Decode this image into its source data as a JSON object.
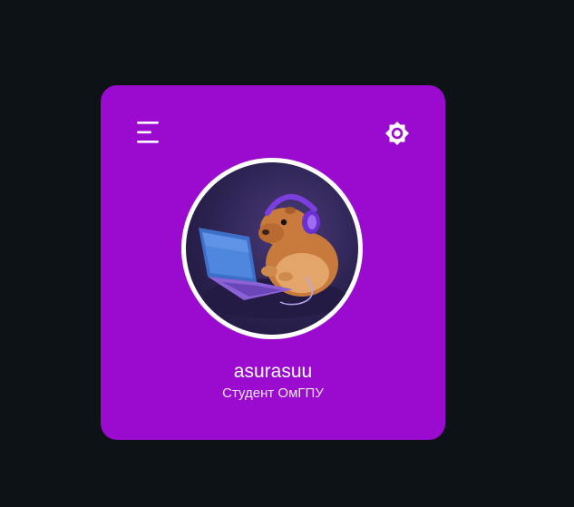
{
  "profile": {
    "username": "asurasuu",
    "subtitle": "Студент ОмГПУ"
  },
  "icons": {
    "menu": "menu-icon",
    "theme": "sun-brightness-icon",
    "avatar": "capybara-with-headphones-and-laptop"
  },
  "colors": {
    "background": "#0d1216",
    "card": "#9a0acf",
    "text": "#ffffff"
  }
}
